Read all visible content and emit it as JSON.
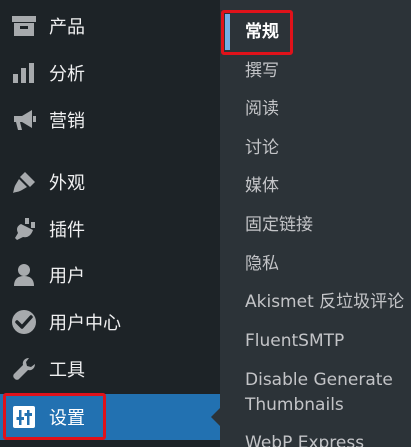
{
  "menu": {
    "items": [
      {
        "label": "产品",
        "icon": "archive-icon"
      },
      {
        "label": "分析",
        "icon": "bar-chart-icon"
      },
      {
        "label": "营销",
        "icon": "megaphone-icon"
      },
      {
        "label": "外观",
        "icon": "paintbrush-icon"
      },
      {
        "label": "插件",
        "icon": "plugin-icon"
      },
      {
        "label": "用户",
        "icon": "user-icon"
      },
      {
        "label": "用户中心",
        "icon": "dashboard-check-icon"
      },
      {
        "label": "工具",
        "icon": "wrench-icon"
      },
      {
        "label": "设置",
        "icon": "settings-sliders-icon"
      }
    ]
  },
  "submenu": {
    "items": [
      {
        "label": "常规"
      },
      {
        "label": "撰写"
      },
      {
        "label": "阅读"
      },
      {
        "label": "讨论"
      },
      {
        "label": "媒体"
      },
      {
        "label": "固定链接"
      },
      {
        "label": "隐私"
      },
      {
        "label": "Akismet 反垃圾评论"
      },
      {
        "label": "FluentSMTP"
      },
      {
        "label": "Disable Generate Thumbnails"
      },
      {
        "label": "WebP Express"
      }
    ]
  },
  "colors": {
    "menu_bg": "#1d2327",
    "submenu_bg": "#2c3338",
    "current_bg": "#2271b1",
    "highlight": "#e0121a",
    "accent": "#72aee6"
  }
}
